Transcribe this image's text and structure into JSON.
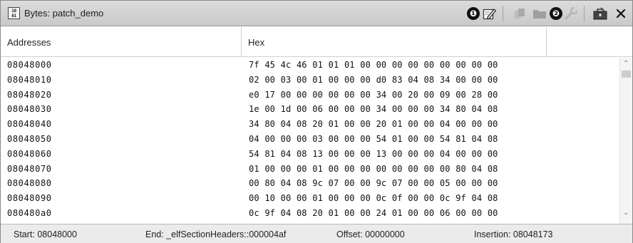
{
  "window": {
    "title": "Bytes: patch_demo",
    "app_icon_text": "10\n01",
    "toolbar": {
      "callout_1": "❶",
      "callout_2": "❷",
      "icons": [
        "patch-edit-icon",
        "copy-icon",
        "folder-icon",
        "wrench-icon",
        "toolbox-icon",
        "close-icon"
      ]
    }
  },
  "columns": {
    "addresses": "Addresses",
    "hex": "Hex"
  },
  "rows": [
    {
      "addr": "08048000",
      "hex": "7f 45 4c 46 01 01 01 00 00 00 00 00 00 00 00 00"
    },
    {
      "addr": "08048010",
      "hex": "02 00 03 00 01 00 00 00 d0 83 04 08 34 00 00 00"
    },
    {
      "addr": "08048020",
      "hex": "e0 17 00 00 00 00 00 00 34 00 20 00 09 00 28 00"
    },
    {
      "addr": "08048030",
      "hex": "1e 00 1d 00 06 00 00 00 34 00 00 00 34 80 04 08"
    },
    {
      "addr": "08048040",
      "hex": "34 80 04 08 20 01 00 00 20 01 00 00 04 00 00 00"
    },
    {
      "addr": "08048050",
      "hex": "04 00 00 00 03 00 00 00 54 01 00 00 54 81 04 08"
    },
    {
      "addr": "08048060",
      "hex": "54 81 04 08 13 00 00 00 13 00 00 00 04 00 00 00"
    },
    {
      "addr": "08048070",
      "hex": "01 00 00 00 01 00 00 00 00 00 00 00 00 80 04 08"
    },
    {
      "addr": "08048080",
      "hex": "00 80 04 08 9c 07 00 00 9c 07 00 00 05 00 00 00"
    },
    {
      "addr": "08048090",
      "hex": "00 10 00 00 01 00 00 00 0c 0f 00 00 0c 9f 04 08"
    },
    {
      "addr": "080480a0",
      "hex": "0c 9f 04 08 20 01 00 00 24 01 00 00 06 00 00 00"
    }
  ],
  "status": {
    "start": "Start: 08048000",
    "end": "End: _elfSectionHeaders::000004af",
    "offset": "Offset: 00000000",
    "insertion": "Insertion: 08048173"
  },
  "colors": {
    "titlebar": "#d2d2d2",
    "statusbar": "#ebebeb",
    "border": "#8a8a8a"
  }
}
